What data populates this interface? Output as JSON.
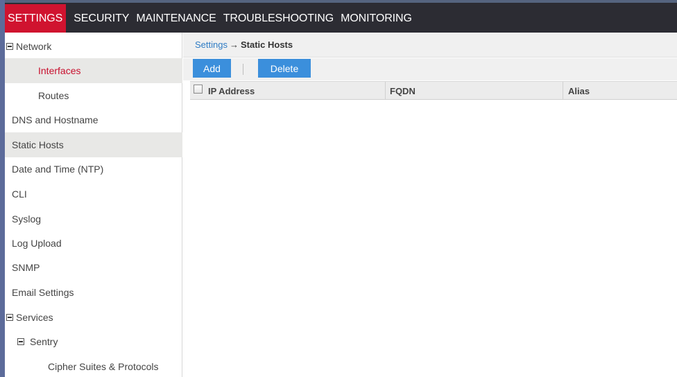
{
  "topnav": {
    "tabs": [
      {
        "label": "SETTINGS",
        "active": true
      },
      {
        "label": "SECURITY"
      },
      {
        "label": "MAINTENANCE"
      },
      {
        "label": "TROUBLESHOOTING"
      },
      {
        "label": "MONITORING"
      }
    ]
  },
  "sidebar": {
    "items": [
      {
        "label": "Network",
        "icon": "collapse-box-icon"
      },
      {
        "label": "Interfaces",
        "state": "selected"
      },
      {
        "label": "Routes"
      },
      {
        "label": "DNS and Hostname"
      },
      {
        "label": "Static Hosts",
        "state": "highlighted"
      },
      {
        "label": "Date and Time (NTP)"
      },
      {
        "label": "CLI"
      },
      {
        "label": "Syslog"
      },
      {
        "label": "Log Upload"
      },
      {
        "label": "SNMP"
      },
      {
        "label": "Email Settings"
      },
      {
        "label": "Services",
        "icon": "collapse-box-icon"
      },
      {
        "label": "Sentry",
        "icon": "collapse-box-icon"
      },
      {
        "label": "Cipher Suites & Protocols"
      }
    ]
  },
  "breadcrumb": {
    "parent": "Settings",
    "separator": "→",
    "current": "Static Hosts"
  },
  "toolbar": {
    "add_label": "Add",
    "delete_label": "Delete"
  },
  "table": {
    "columns": [
      "IP Address",
      "FQDN",
      "Alias"
    ],
    "rows": []
  },
  "colors": {
    "active_tab": "#d0132f",
    "nav_bg": "#2c2c33",
    "button": "#3b8fdc",
    "link": "#2e7bc4",
    "selected_text": "#c8102e"
  }
}
